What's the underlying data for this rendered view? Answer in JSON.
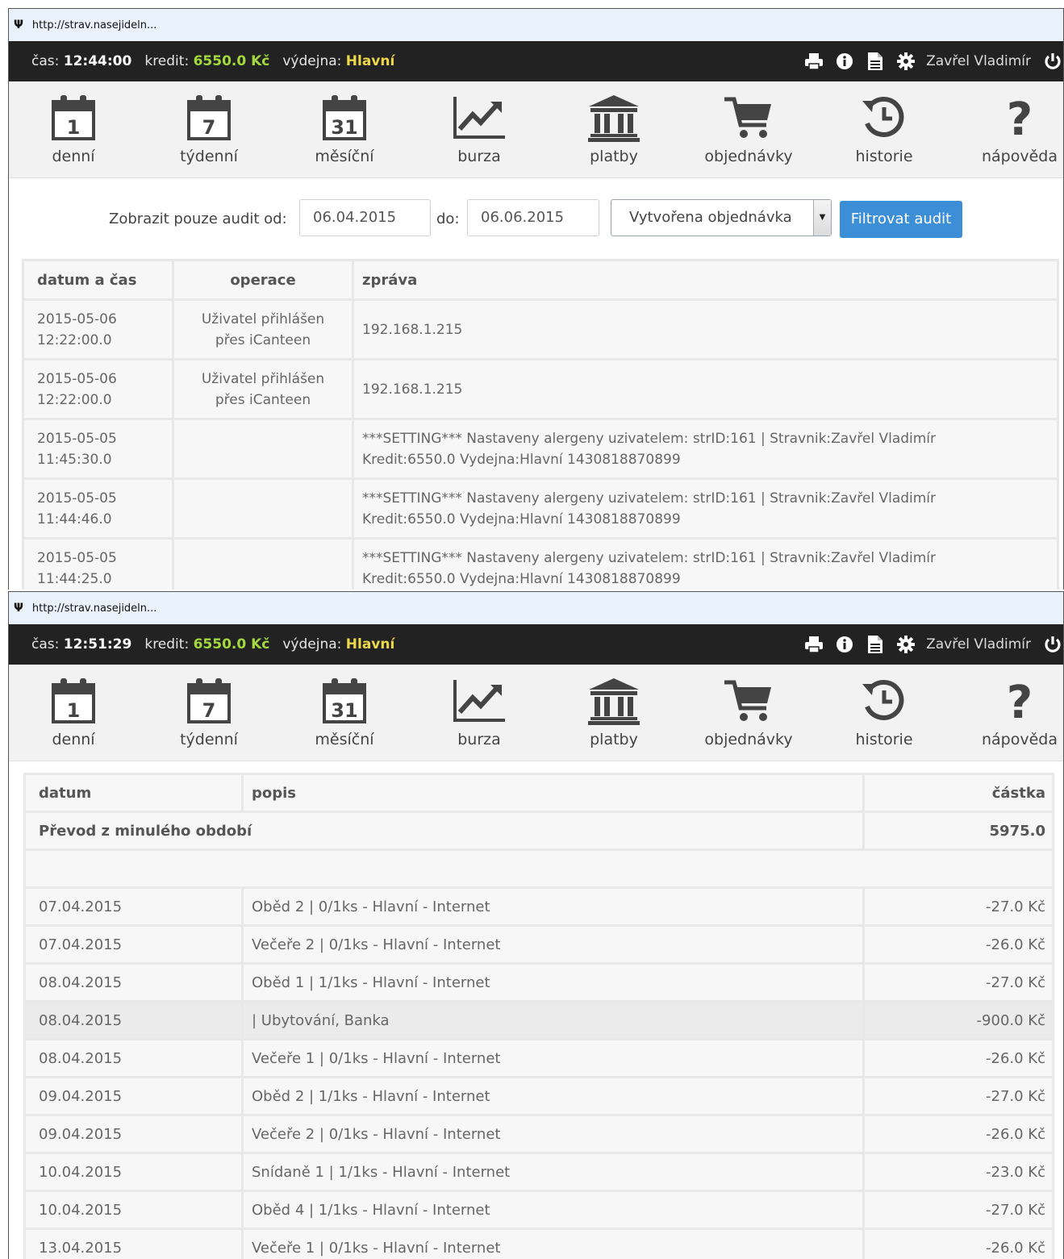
{
  "screenshot1": {
    "url": "http://strav.nasejideln...",
    "status": {
      "time_label": "čas:",
      "time": "12:44:00",
      "credit_label": "kredit:",
      "credit": "6550.0 Kč",
      "canteen_label": "výdejna:",
      "canteen": "Hlavní",
      "user": "Zavřel Vladimír"
    },
    "nav": [
      "denní",
      "týdenní",
      "měsíční",
      "burza",
      "platby",
      "objednávky",
      "historie",
      "nápověda"
    ],
    "filter": {
      "label": "Zobrazit pouze audit od:",
      "from": "06.04.2015",
      "to_label": "do:",
      "to": "06.06.2015",
      "type": "Vytvořena objednávka",
      "button": "Filtrovat audit"
    },
    "audit": {
      "headers": [
        "datum a čas",
        "operace",
        "zpráva"
      ],
      "rows": [
        {
          "date": "2015-05-06",
          "time": "12:22:00.0",
          "op1": "Uživatel přihlášen",
          "op2": "přes iCanteen",
          "msg1": "192.168.1.215",
          "msg2": ""
        },
        {
          "date": "2015-05-06",
          "time": "12:22:00.0",
          "op1": "Uživatel přihlášen",
          "op2": "přes iCanteen",
          "msg1": "192.168.1.215",
          "msg2": ""
        },
        {
          "date": "2015-05-05",
          "time": "11:45:30.0",
          "op1": "",
          "op2": "",
          "msg1": "***SETTING*** Nastaveny alergeny uzivatelem: strID:161 | Stravnik:Zavřel Vladimír",
          "msg2": "Kredit:6550.0 Vydejna:Hlavní 1430818870899"
        },
        {
          "date": "2015-05-05",
          "time": "11:44:46.0",
          "op1": "",
          "op2": "",
          "msg1": "***SETTING*** Nastaveny alergeny uzivatelem: strID:161 | Stravnik:Zavřel Vladimír",
          "msg2": "Kredit:6550.0 Vydejna:Hlavní 1430818870899"
        },
        {
          "date": "2015-05-05",
          "time": "11:44:25.0",
          "op1": "",
          "op2": "",
          "msg1": "***SETTING*** Nastaveny alergeny uzivatelem: strID:161 | Stravnik:Zavřel Vladimír",
          "msg2": "Kredit:6550.0 Vydejna:Hlavní 1430818870899"
        }
      ]
    }
  },
  "screenshot2": {
    "url": "http://strav.nasejideln...",
    "status": {
      "time_label": "čas:",
      "time": "12:51:29",
      "credit_label": "kredit:",
      "credit": "6550.0 Kč",
      "canteen_label": "výdejna:",
      "canteen": "Hlavní",
      "user": "Zavřel Vladimír"
    },
    "nav": [
      "denní",
      "týdenní",
      "měsíční",
      "burza",
      "platby",
      "objednávky",
      "historie",
      "nápověda"
    ],
    "history": {
      "headers": [
        "datum",
        "popis",
        "částka"
      ],
      "carry_label": "Převod z minulého období",
      "carry_value": "5975.0",
      "rows": [
        {
          "date": "07.04.2015",
          "desc": "Oběd 2 | 0/1ks - Hlavní - Internet",
          "amount": "-27.0 Kč"
        },
        {
          "date": "07.04.2015",
          "desc": "Večeře 2 | 0/1ks - Hlavní - Internet",
          "amount": "-26.0 Kč"
        },
        {
          "date": "08.04.2015",
          "desc": "Oběd 1 | 1/1ks - Hlavní - Internet",
          "amount": "-27.0 Kč"
        },
        {
          "date": "08.04.2015",
          "desc": "| Ubytování, Banka",
          "amount": "-900.0 Kč"
        },
        {
          "date": "08.04.2015",
          "desc": "Večeře 1 | 0/1ks - Hlavní - Internet",
          "amount": "-26.0 Kč"
        },
        {
          "date": "09.04.2015",
          "desc": "Oběd 2 | 1/1ks - Hlavní - Internet",
          "amount": "-27.0 Kč"
        },
        {
          "date": "09.04.2015",
          "desc": "Večeře 2 | 0/1ks - Hlavní - Internet",
          "amount": "-26.0 Kč"
        },
        {
          "date": "10.04.2015",
          "desc": "Snídaně 1 | 1/1ks - Hlavní - Internet",
          "amount": "-23.0 Kč"
        },
        {
          "date": "10.04.2015",
          "desc": "Oběd 4 | 1/1ks - Hlavní - Internet",
          "amount": "-27.0 Kč"
        },
        {
          "date": "13.04.2015",
          "desc": "Večeře 1 | 0/1ks - Hlavní - Internet",
          "amount": "-26.0 Kč"
        }
      ]
    }
  },
  "icons": [
    "cutlery-icon",
    "print-icon",
    "info-icon",
    "document-icon",
    "gear-icon",
    "power-icon",
    "calendar-1-icon",
    "calendar-7-icon",
    "calendar-31-icon",
    "chart-icon",
    "bank-icon",
    "cart-icon",
    "history-icon",
    "question-icon"
  ],
  "colors": {
    "topbar": "#222222",
    "credit": "#a4d93e",
    "canteen": "#ecd84a",
    "button": "#3c8fd6"
  }
}
